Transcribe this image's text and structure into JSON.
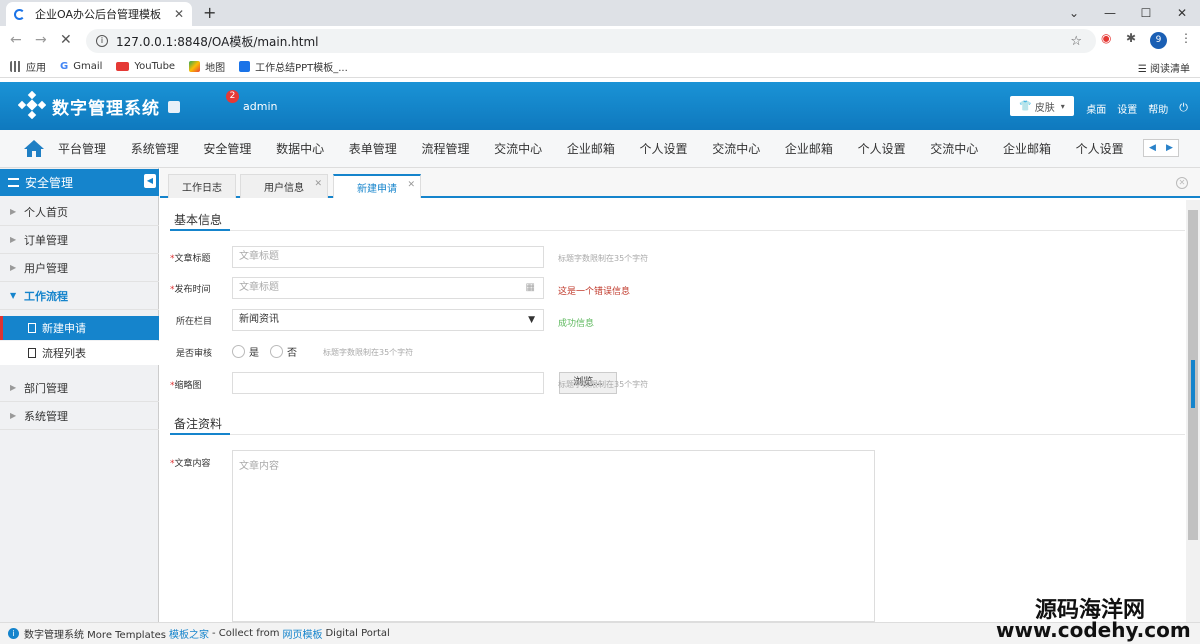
{
  "browser": {
    "tab_title": "企业OA办公后台管理模板",
    "url": "127.0.0.1:8848/OA模板/main.html",
    "bookmarks": [
      "应用",
      "Gmail",
      "YouTube",
      "地图",
      "工作总结PPT模板_..."
    ],
    "reading_list": "阅读清单",
    "profile_initial": "9"
  },
  "header": {
    "app_title": "数字管理系统",
    "notification_count": "2",
    "username": "admin",
    "skin_label": "皮肤",
    "links": [
      "桌面",
      "设置",
      "帮助"
    ]
  },
  "top_menu": [
    "平台管理",
    "系统管理",
    "安全管理",
    "数据中心",
    "表单管理",
    "流程管理",
    "交流中心",
    "企业邮箱",
    "个人设置",
    "交流中心",
    "企业邮箱",
    "个人设置",
    "交流中心",
    "企业邮箱",
    "个人设置"
  ],
  "sidebar": {
    "title": "安全管理",
    "items": [
      "个人首页",
      "订单管理",
      "用户管理",
      "工作流程",
      "部门管理",
      "系统管理"
    ],
    "sub_items": [
      "新建申请",
      "流程列表"
    ]
  },
  "page_tabs": [
    "工作日志",
    "用户信息",
    "新建申请"
  ],
  "form": {
    "section_basic": "基本信息",
    "section_remark": "备注资料",
    "title_label": "文章标题",
    "title_placeholder": "文章标题",
    "title_hint": "标题字数限制在35个字符",
    "time_label": "发布时间",
    "time_placeholder": "文章标题",
    "time_error": "这是一个错误信息",
    "column_label": "所在栏目",
    "column_value": "新闻资讯",
    "column_success": "成功信息",
    "audit_label": "是否审核",
    "audit_yes": "是",
    "audit_no": "否",
    "audit_hint": "标题字数限制在35个字符",
    "thumb_label": "缩略图",
    "browse_label": "浏览...",
    "thumb_hint": "标题字数限制在35个字符",
    "content_label": "文章内容",
    "content_placeholder": "文章内容"
  },
  "status_bar": {
    "prefix": "数字管理系统 More Templates",
    "link1": "模板之家",
    "middle": "- Collect from",
    "link2": "网页模板",
    "suffix": "Digital Portal"
  },
  "watermark": {
    "line1": "源码海洋网",
    "line2": "www.codehy.com"
  },
  "colors": {
    "primary": "#1584cc",
    "error": "#c0392b",
    "success": "#5cb85c"
  }
}
